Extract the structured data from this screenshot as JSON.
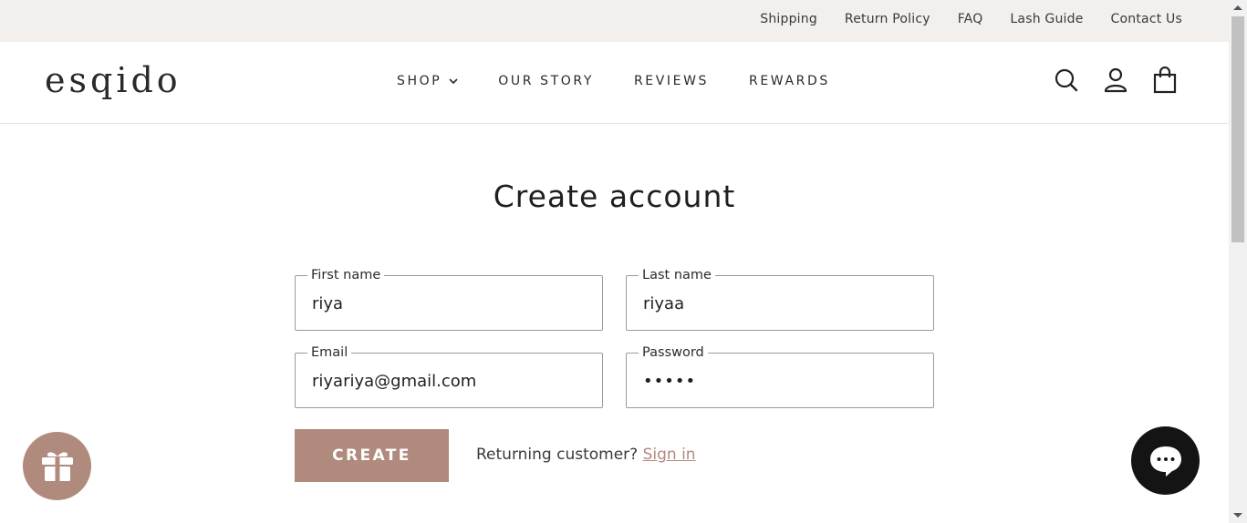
{
  "utility": {
    "links": [
      "Shipping",
      "Return Policy",
      "FAQ",
      "Lash Guide",
      "Contact Us"
    ]
  },
  "header": {
    "logo": "esqido",
    "nav": [
      {
        "label": "SHOP"
      },
      {
        "label": "OUR STORY"
      },
      {
        "label": "REVIEWS"
      },
      {
        "label": "REWARDS"
      }
    ],
    "icons": [
      "search-icon",
      "account-icon",
      "cart-icon"
    ]
  },
  "form": {
    "title": "Create account",
    "first_name": {
      "label": "First name",
      "value": "riya"
    },
    "last_name": {
      "label": "Last name",
      "value": "riyaa"
    },
    "email": {
      "label": "Email",
      "value": "riyariya@gmail.com"
    },
    "password": {
      "label": "Password",
      "value": "•••••"
    },
    "create_label": "CREATE",
    "returning_text": "Returning customer? ",
    "sign_in_label": "Sign in"
  },
  "floating": {
    "gift_icon": "gift-icon",
    "chat_icon": "chat-bubble-icon"
  },
  "colors": {
    "accent": "#b08a7d",
    "utility_bg": "#f2efed",
    "chat_bg": "#141414"
  }
}
